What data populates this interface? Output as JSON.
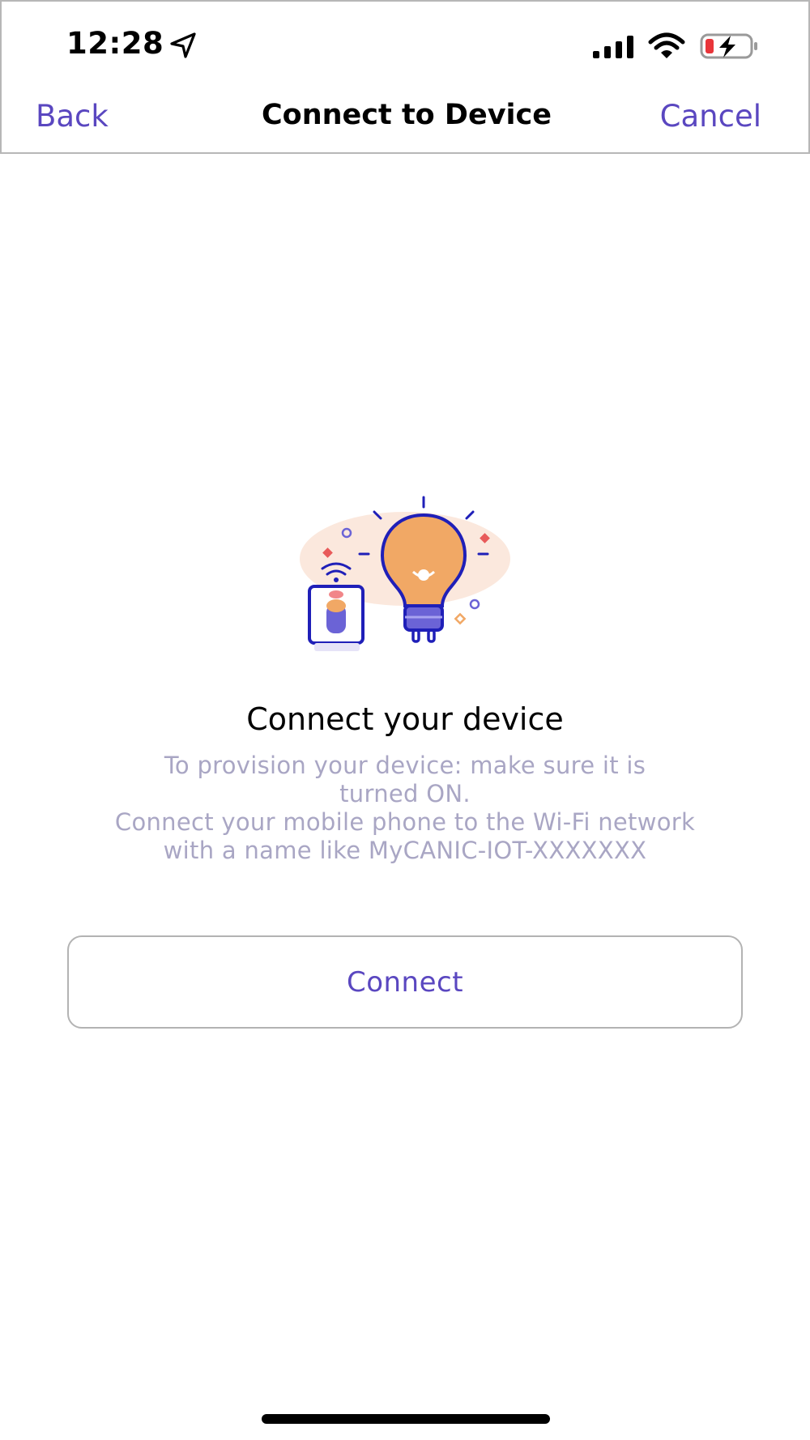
{
  "status_bar": {
    "time": "12:28",
    "icons": [
      "location-arrow-icon",
      "cellular-signal-icon",
      "wifi-icon",
      "battery-charging-icon"
    ]
  },
  "nav": {
    "back_label": "Back",
    "title": "Connect to Device",
    "cancel_label": "Cancel"
  },
  "content": {
    "illustration": "lightbulb-smart-device-illustration",
    "title": "Connect your device",
    "description_lines": [
      "To provision your device: make sure it is",
      "turned ON.",
      "Connect your mobile phone to the Wi-Fi network",
      "with a name like MyCANIC-IOT-XXXXXXX"
    ],
    "connect_label": "Connect"
  },
  "colors": {
    "accent": "#5a47c0",
    "description_text": "#a9a6c4",
    "bulb_orange": "#f1a865",
    "device_blue": "#1f1fb8",
    "battery_red": "#e8353a"
  }
}
